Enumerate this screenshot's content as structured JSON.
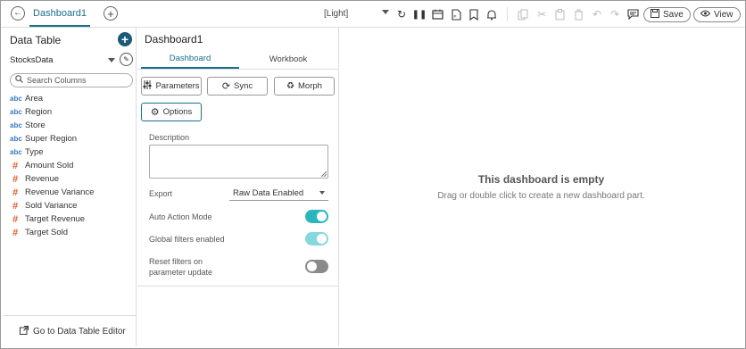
{
  "header": {
    "dashboard_tab": "Dashboard1",
    "theme": "[Light]",
    "save_label": "Save",
    "view_label": "View"
  },
  "data_table": {
    "title": "Data Table",
    "datasource": "StocksData",
    "search_placeholder": "Search Columns",
    "columns": [
      {
        "type": "abc",
        "name": "Area"
      },
      {
        "type": "abc",
        "name": "Region"
      },
      {
        "type": "abc",
        "name": "Store"
      },
      {
        "type": "abc",
        "name": "Super Region"
      },
      {
        "type": "abc",
        "name": "Type"
      },
      {
        "type": "#",
        "name": "Amount Sold"
      },
      {
        "type": "#",
        "name": "Revenue"
      },
      {
        "type": "#",
        "name": "Revenue Variance"
      },
      {
        "type": "#",
        "name": "Sold Variance"
      },
      {
        "type": "#",
        "name": "Target Revenue"
      },
      {
        "type": "#",
        "name": "Target Sold"
      }
    ],
    "footer_label": "Go to Data Table Editor"
  },
  "properties": {
    "title": "Dashboard1",
    "tabs": [
      "Dashboard",
      "Workbook"
    ],
    "buttons": {
      "parameters": "Parameters",
      "sync": "Sync",
      "morph": "Morph",
      "options": "Options"
    },
    "description_label": "Description",
    "export_label": "Export",
    "export_value": "Raw Data Enabled",
    "auto_action_label": "Auto Action Mode",
    "auto_action_on": true,
    "global_filters_label": "Global filters enabled",
    "global_filters_on": true,
    "reset_filters_label_1": "Reset filters on",
    "reset_filters_label_2": "parameter update",
    "reset_filters_on": false
  },
  "canvas": {
    "empty_title": "This dashboard is empty",
    "empty_subtitle": "Drag or double click to create a new dashboard part."
  },
  "colors": {
    "accent": "#1a6f8f",
    "toggle_on": "#2cb5bd",
    "text_type": "#3a78c2",
    "numeric_type": "#e05a2a"
  }
}
